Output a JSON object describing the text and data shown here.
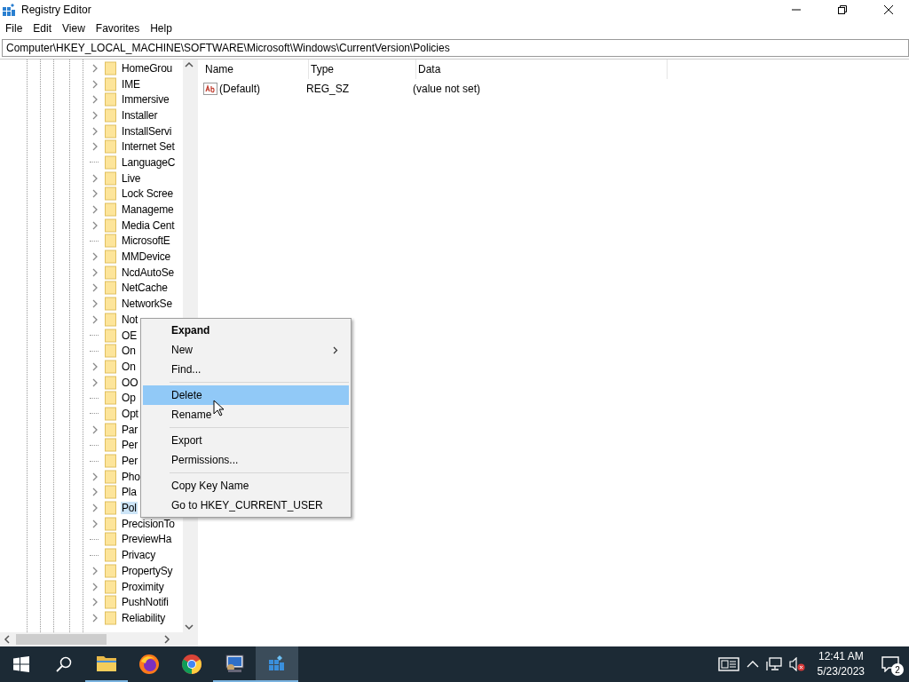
{
  "window": {
    "title": "Registry Editor"
  },
  "menu_bar": [
    "File",
    "Edit",
    "View",
    "Favorites",
    "Help"
  ],
  "address": "Computer\\HKEY_LOCAL_MACHINE\\SOFTWARE\\Microsoft\\Windows\\CurrentVersion\\Policies",
  "tree": {
    "items": [
      {
        "name": "HomeGrou",
        "expandable": true,
        "selected": false
      },
      {
        "name": "IME",
        "expandable": true,
        "selected": false
      },
      {
        "name": "Immersive",
        "expandable": true,
        "selected": false
      },
      {
        "name": "Installer",
        "expandable": true,
        "selected": false
      },
      {
        "name": "InstallServi",
        "expandable": true,
        "selected": false
      },
      {
        "name": "Internet Set",
        "expandable": true,
        "selected": false
      },
      {
        "name": "LanguageC",
        "expandable": false,
        "selected": false
      },
      {
        "name": "Live",
        "expandable": true,
        "selected": false
      },
      {
        "name": "Lock Scree",
        "expandable": true,
        "selected": false
      },
      {
        "name": "Manageme",
        "expandable": true,
        "selected": false
      },
      {
        "name": "Media Cent",
        "expandable": true,
        "selected": false
      },
      {
        "name": "MicrosoftE",
        "expandable": false,
        "selected": false
      },
      {
        "name": "MMDevice",
        "expandable": true,
        "selected": false
      },
      {
        "name": "NcdAutoSe",
        "expandable": true,
        "selected": false
      },
      {
        "name": "NetCache",
        "expandable": true,
        "selected": false
      },
      {
        "name": "NetworkSe",
        "expandable": true,
        "selected": false
      },
      {
        "name": "Not",
        "expandable": true,
        "selected": false
      },
      {
        "name": "OE",
        "expandable": false,
        "selected": false
      },
      {
        "name": "On",
        "expandable": false,
        "selected": false
      },
      {
        "name": "On",
        "expandable": true,
        "selected": false
      },
      {
        "name": "OO",
        "expandable": true,
        "selected": false
      },
      {
        "name": "Op",
        "expandable": false,
        "selected": false
      },
      {
        "name": "Opt",
        "expandable": false,
        "selected": false
      },
      {
        "name": "Par",
        "expandable": true,
        "selected": false
      },
      {
        "name": "Per",
        "expandable": false,
        "selected": false
      },
      {
        "name": "Per",
        "expandable": false,
        "selected": false
      },
      {
        "name": "Pho",
        "expandable": true,
        "selected": false
      },
      {
        "name": "Pla",
        "expandable": true,
        "selected": false
      },
      {
        "name": "Pol",
        "expandable": true,
        "selected": true
      },
      {
        "name": "PrecisionTo",
        "expandable": true,
        "selected": false
      },
      {
        "name": "PreviewHa",
        "expandable": false,
        "selected": false
      },
      {
        "name": "Privacy",
        "expandable": false,
        "selected": false
      },
      {
        "name": "PropertySy",
        "expandable": true,
        "selected": false
      },
      {
        "name": "Proximity",
        "expandable": true,
        "selected": false
      },
      {
        "name": "PushNotifi",
        "expandable": true,
        "selected": false
      },
      {
        "name": "Reliability",
        "expandable": true,
        "selected": false
      }
    ]
  },
  "values": {
    "columns": [
      "Name",
      "Type",
      "Data"
    ],
    "rows": [
      {
        "name": "(Default)",
        "type": "REG_SZ",
        "data": "(value not set)"
      }
    ]
  },
  "context_menu": [
    {
      "kind": "item",
      "label": "Expand",
      "default": true,
      "submenu": false,
      "selected": false
    },
    {
      "kind": "item",
      "label": "New",
      "default": false,
      "submenu": true,
      "selected": false
    },
    {
      "kind": "item",
      "label": "Find...",
      "default": false,
      "submenu": false,
      "selected": false
    },
    {
      "kind": "separator"
    },
    {
      "kind": "item",
      "label": "Delete",
      "default": false,
      "submenu": false,
      "selected": true
    },
    {
      "kind": "item",
      "label": "Rename",
      "default": false,
      "submenu": false,
      "selected": false
    },
    {
      "kind": "separator"
    },
    {
      "kind": "item",
      "label": "Export",
      "default": false,
      "submenu": false,
      "selected": false
    },
    {
      "kind": "item",
      "label": "Permissions...",
      "default": false,
      "submenu": false,
      "selected": false
    },
    {
      "kind": "separator"
    },
    {
      "kind": "item",
      "label": "Copy Key Name",
      "default": false,
      "submenu": false,
      "selected": false
    },
    {
      "kind": "item",
      "label": "Go to HKEY_CURRENT_USER",
      "default": false,
      "submenu": false,
      "selected": false
    }
  ],
  "taskbar": {
    "apps": [
      {
        "kind": "folder",
        "running": true,
        "active": false
      },
      {
        "kind": "firefox",
        "running": false,
        "active": false
      },
      {
        "kind": "chrome",
        "running": false,
        "active": false
      },
      {
        "kind": "computer",
        "running": true,
        "active": false
      },
      {
        "kind": "registry",
        "running": true,
        "active": true
      }
    ],
    "time": "12:41 AM",
    "date": "5/23/2023",
    "notification_count": "2"
  }
}
